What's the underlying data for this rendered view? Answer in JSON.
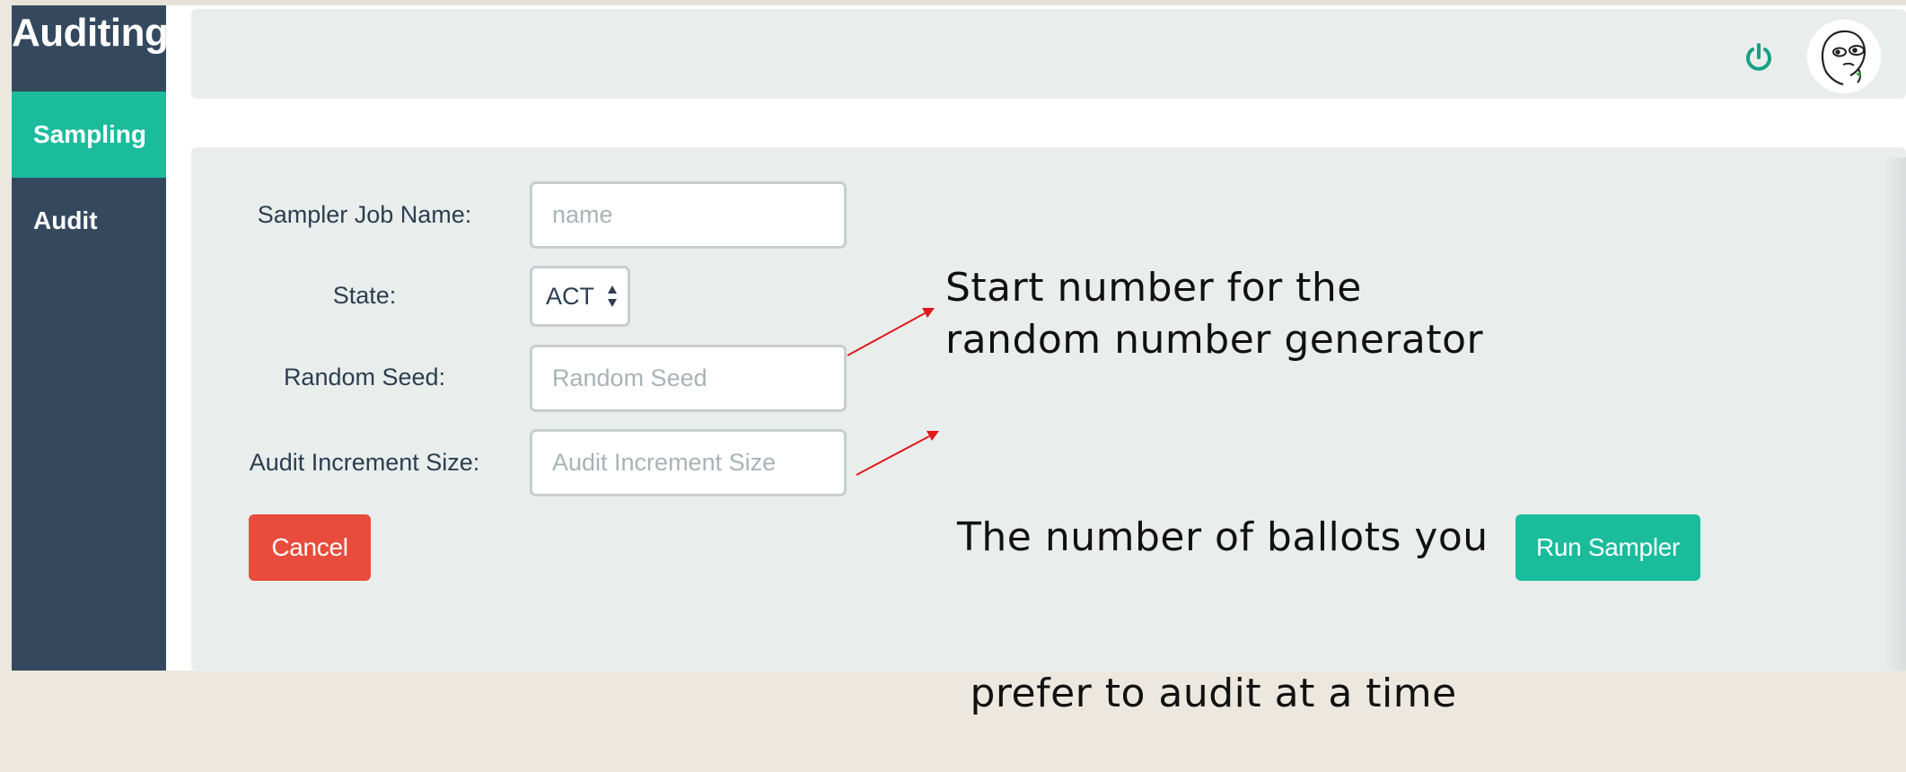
{
  "sidebar": {
    "brand": "Auditing",
    "items": [
      {
        "label": "Sampling",
        "active": true
      },
      {
        "label": "Audit",
        "active": false
      }
    ]
  },
  "topbar": {
    "power_icon": "power-icon",
    "avatar_icon": "avatar-icon"
  },
  "form": {
    "job_name": {
      "label": "Sampler Job Name:",
      "value": "",
      "placeholder": "name"
    },
    "state": {
      "label": "State:",
      "value": "ACT"
    },
    "random_seed": {
      "label": "Random Seed:",
      "value": "",
      "placeholder": "Random Seed"
    },
    "increment": {
      "label": "Audit Increment Size:",
      "value": "",
      "placeholder": "Audit Increment Size"
    },
    "cancel_label": "Cancel",
    "run_label": "Run Sampler"
  },
  "annotations": {
    "seed_line1": "Start number for the",
    "seed_line2": "random number generator",
    "increment_line1": "The number of ballots you",
    "increment_line2": " prefer to audit at a time"
  },
  "colors": {
    "sidebar": "#34495e",
    "accent": "#1abc9c",
    "danger": "#e74c3c",
    "panel": "#e9eeed",
    "annotation_arrow": "#e0191b"
  }
}
